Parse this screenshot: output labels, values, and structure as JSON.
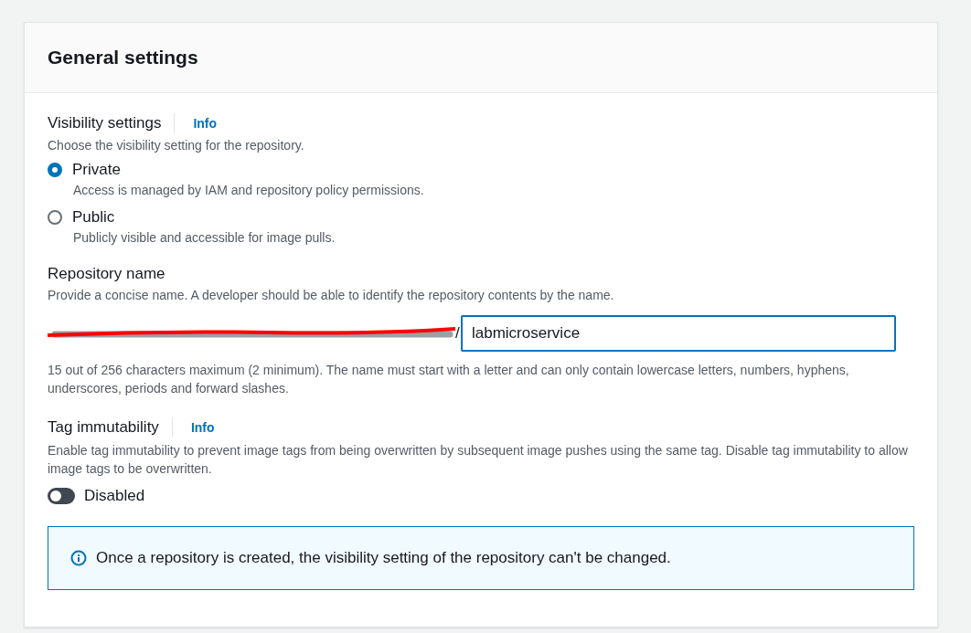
{
  "panel": {
    "title": "General settings"
  },
  "visibility": {
    "label": "Visibility settings",
    "info": "Info",
    "description": "Choose the visibility setting for the repository.",
    "options": [
      {
        "label": "Private",
        "description": "Access is managed by IAM and repository policy permissions.",
        "selected": true
      },
      {
        "label": "Public",
        "description": "Publicly visible and accessible for image pulls.",
        "selected": false
      }
    ]
  },
  "repository_name": {
    "label": "Repository name",
    "description": "Provide a concise name. A developer should be able to identify the repository contents by the name.",
    "prefix": "/",
    "value": "labmicroservice",
    "hint": "15 out of 256 characters maximum (2 minimum). The name must start with a letter and can only contain lowercase letters, numbers, hyphens, underscores, periods and forward slashes."
  },
  "tag_immutability": {
    "label": "Tag immutability",
    "info": "Info",
    "description": "Enable tag immutability to prevent image tags from being overwritten by subsequent image pushes using the same tag. Disable tag immutability to allow image tags to be overwritten.",
    "toggle": {
      "label": "Disabled",
      "on": false
    }
  },
  "alert": {
    "text": "Once a repository is created, the visibility setting of the repository can't be changed."
  }
}
